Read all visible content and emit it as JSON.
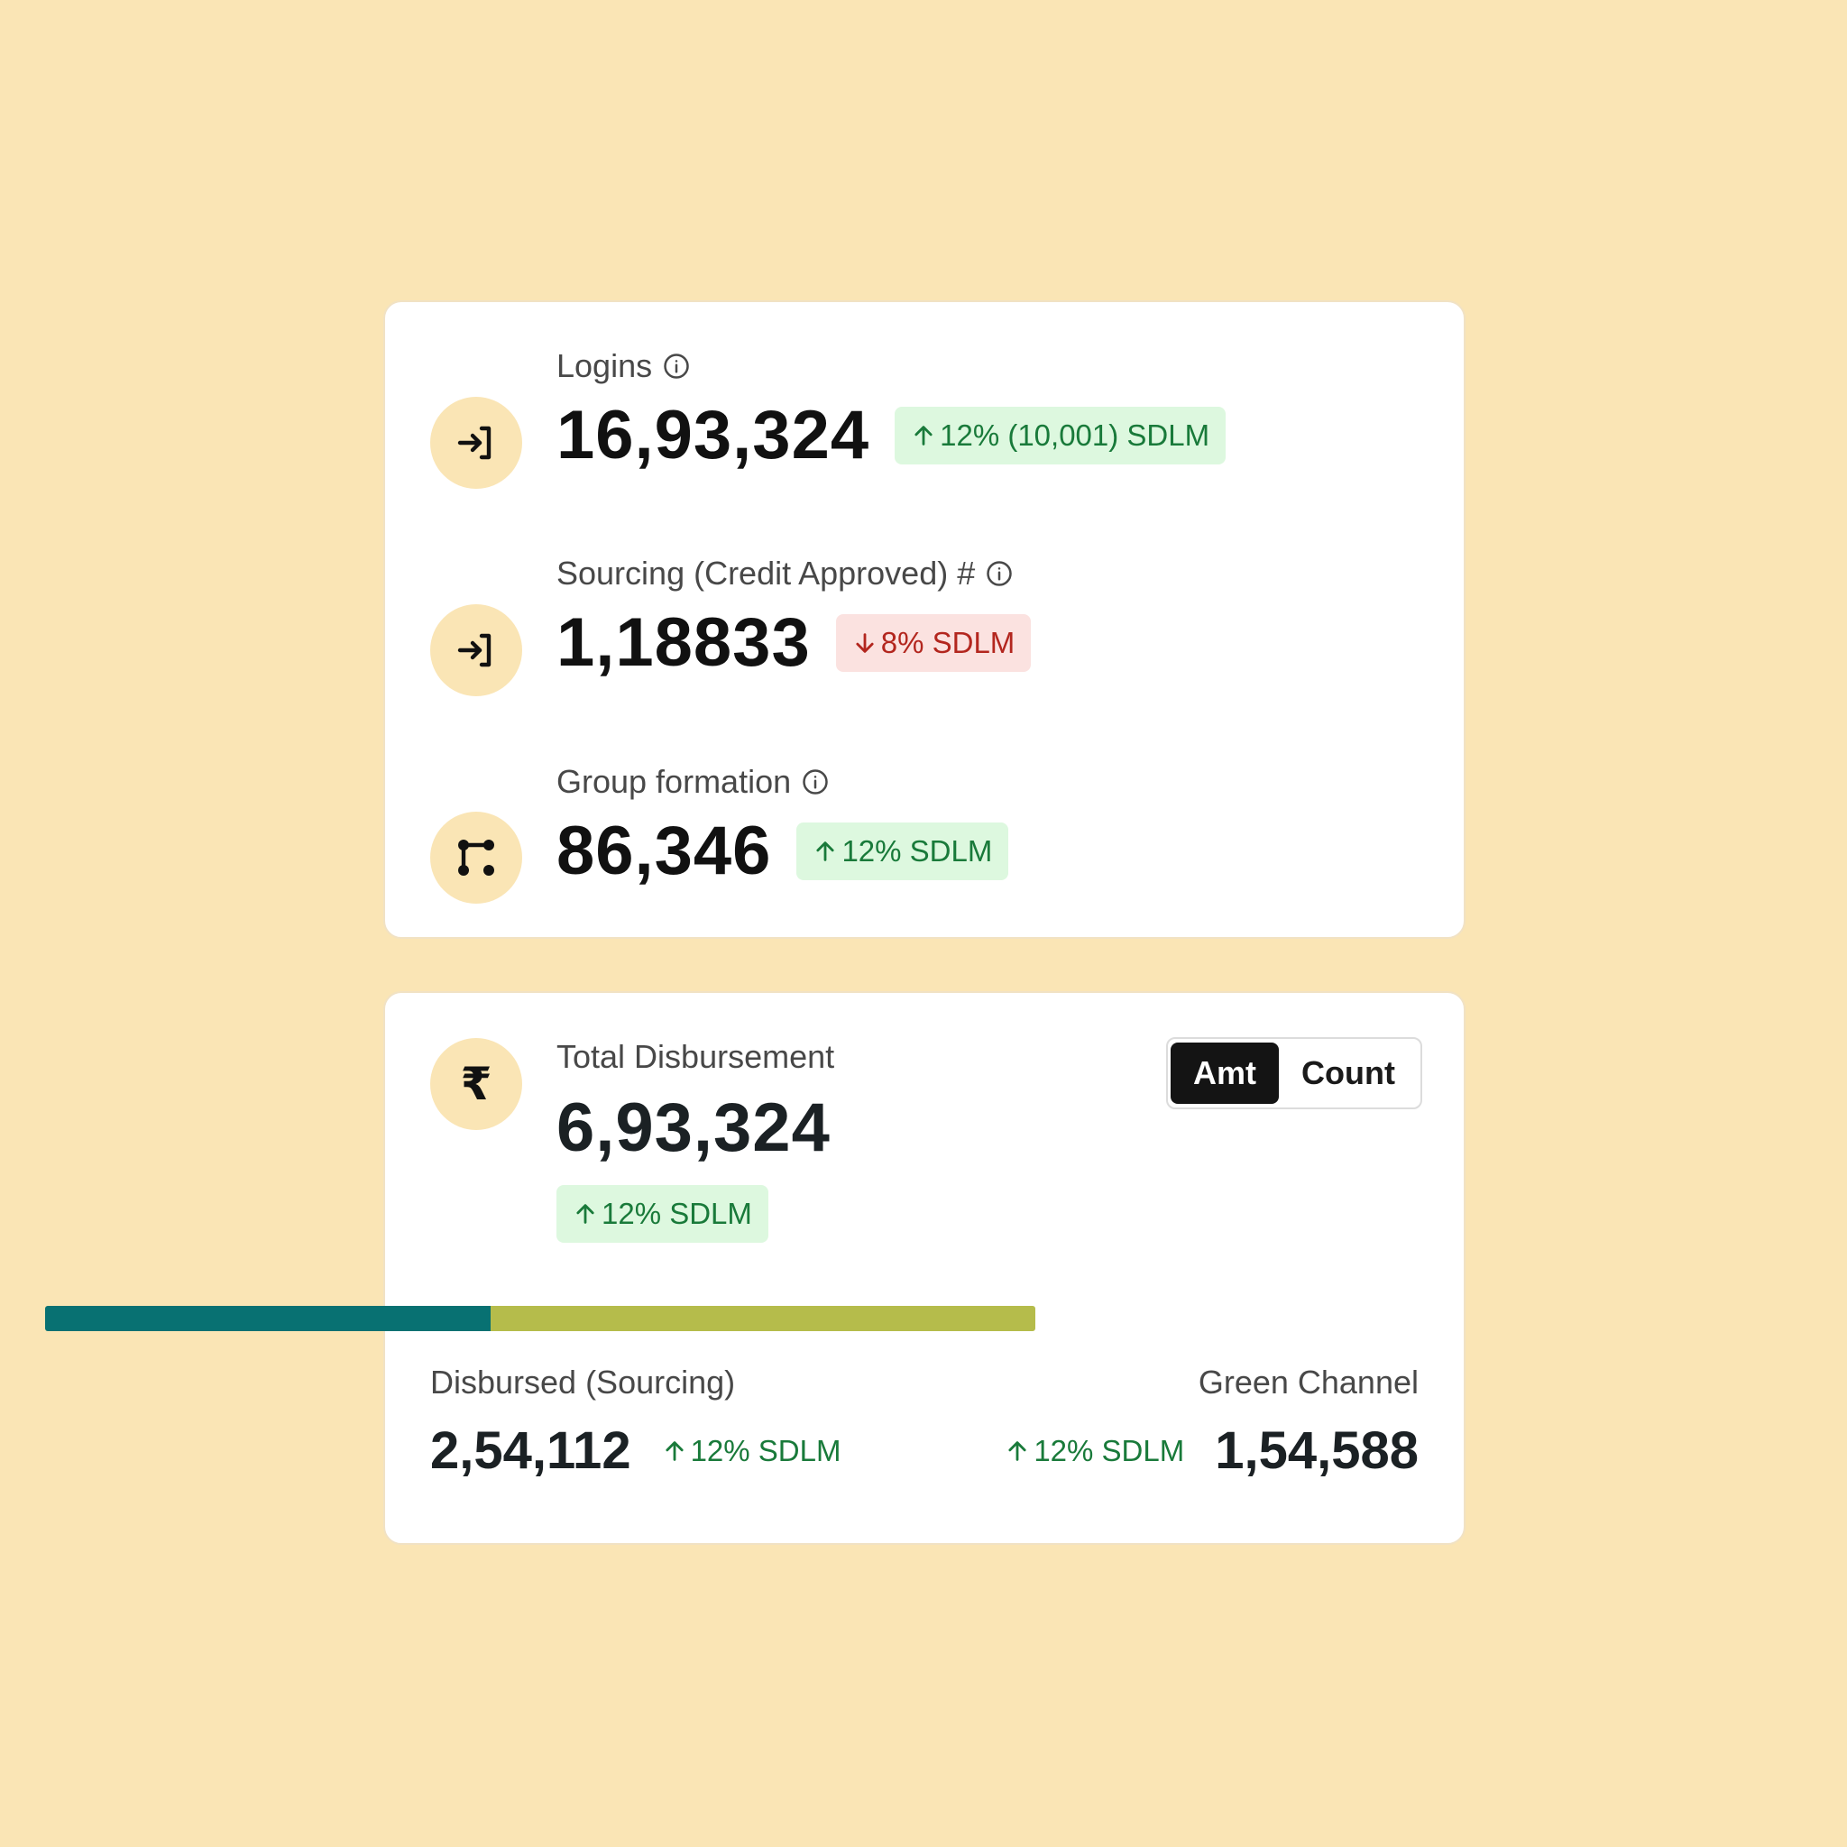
{
  "metrics": [
    {
      "label": "Logins",
      "value": "16,93,324",
      "change": "12% (10,001) SDLM",
      "trend": "up",
      "icon": "login-arrow-icon"
    },
    {
      "label": "Sourcing (Credit Approved) #",
      "value": "1,18833",
      "change": "8% SDLM",
      "trend": "down",
      "icon": "login-arrow-icon"
    },
    {
      "label": "Group formation",
      "value": "86,346",
      "change": "12% SDLM",
      "trend": "up",
      "icon": "group-network-icon"
    }
  ],
  "disbursement": {
    "icon": "rupee-icon",
    "label": "Total Disbursement",
    "value": "6,93,324",
    "change": "12% SDLM",
    "toggle": {
      "options": [
        "Amt",
        "Count"
      ],
      "selected": "Amt"
    },
    "split": {
      "sourcing_fraction": 0.45,
      "colors": {
        "sourcing": "#087172",
        "green_channel": "#B5BC4B"
      }
    },
    "sourcing": {
      "label": "Disbursed (Sourcing)",
      "value": "2,54,112",
      "change": "12% SDLM"
    },
    "green_channel": {
      "label": "Green Channel",
      "value": "1,54,588",
      "change": "12% SDLM"
    }
  },
  "colors": {
    "background": "#FAE5B5",
    "up": "#197A3A",
    "up_bg": "#DDF8DF",
    "down": "#B3261E",
    "down_bg": "#FBE2E0"
  }
}
